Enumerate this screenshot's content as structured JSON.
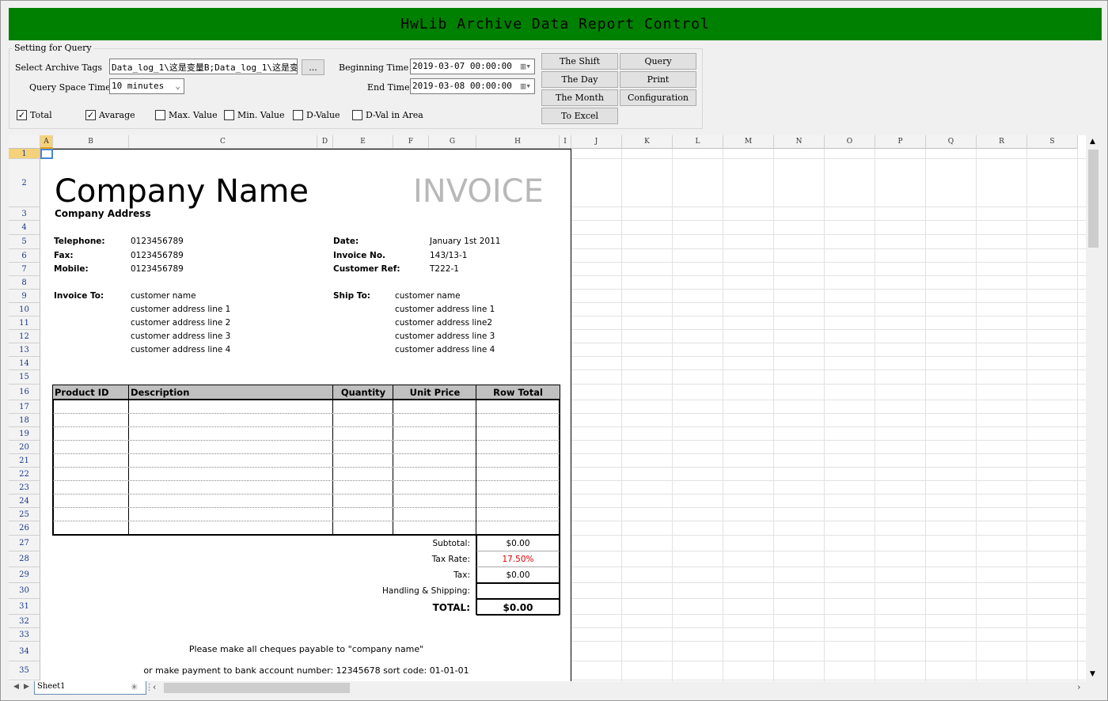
{
  "title": "HwLib Archive Data Report Control",
  "query": {
    "group_title": "Setting for Query",
    "tags_label": "Select Archive Tags",
    "tags_value": "Data_log_1\\这是变量B;Data_log_1\\这是变量",
    "browse_label": "...",
    "space_label": "Query Space Time",
    "space_value": "10 minutes",
    "begin_label": "Beginning Time",
    "begin_value": "2019-03-07 00:00:00",
    "end_label": "End Time",
    "end_value": "2019-03-08 00:00:00",
    "checkboxes": [
      {
        "label": "Total",
        "checked": true
      },
      {
        "label": "Avarage",
        "checked": true
      },
      {
        "label": "Max. Value",
        "checked": false
      },
      {
        "label": "Min. Value",
        "checked": false
      },
      {
        "label": "D-Value",
        "checked": false
      },
      {
        "label": "D-Val in Area",
        "checked": false
      }
    ],
    "buttons": {
      "shift": "The Shift",
      "query": "Query",
      "day": "The Day",
      "print": "Print",
      "month": "The Month",
      "config": "Configuration",
      "excel": "To Excel"
    }
  },
  "columns": [
    "A",
    "B",
    "C",
    "D",
    "E",
    "F",
    "G",
    "H",
    "I",
    "J",
    "K",
    "L",
    "M",
    "N",
    "O",
    "P",
    "Q",
    "R",
    "S"
  ],
  "rows": [
    "1",
    "2",
    "3",
    "4",
    "5",
    "6",
    "7",
    "8",
    "9",
    "10",
    "11",
    "12",
    "13",
    "14",
    "15",
    "16",
    "17",
    "18",
    "19",
    "20",
    "21",
    "22",
    "23",
    "24",
    "25",
    "26",
    "27",
    "28",
    "29",
    "30",
    "31",
    "32",
    "33",
    "34",
    "35"
  ],
  "invoice": {
    "company": "Company Name",
    "title": "INVOICE",
    "address": "Company Address",
    "telephone_label": "Telephone:",
    "telephone": "0123456789",
    "fax_label": "Fax:",
    "fax": "0123456789",
    "mobile_label": "Mobile:",
    "mobile": "0123456789",
    "date_label": "Date:",
    "date": "January 1st 2011",
    "invno_label": "Invoice No.",
    "invno": "143/13-1",
    "custref_label": "Customer Ref:",
    "custref": "T222-1",
    "invoice_to_label": "Invoice To:",
    "invoice_to": [
      "customer name",
      "customer address line 1",
      "customer address line 2",
      "customer address line 3",
      "customer address line 4"
    ],
    "ship_to_label": "Ship To:",
    "ship_to": [
      "customer name",
      "customer address line 1",
      "customer address line2",
      "customer address line 3",
      "customer address line 4"
    ],
    "table_headers": [
      "Product ID",
      "Description",
      "Quantity",
      "Unit Price",
      "Row Total"
    ],
    "subtotal_label": "Subtotal:",
    "subtotal": "$0.00",
    "taxrate_label": "Tax Rate:",
    "taxrate": "17.50%",
    "tax_label": "Tax:",
    "tax": "$0.00",
    "shipping_label": "Handling & Shipping:",
    "shipping": "",
    "total_label": "TOTAL:",
    "total": "$0.00",
    "note1": "Please make all cheques payable to \"company name\"",
    "note2": "or make payment to bank account number: 12345678 sort code: 01-01-01"
  },
  "sheet_tab": "Sheet1",
  "colors": {
    "title_bg": "#008000",
    "tax_rate": "#e00000"
  }
}
